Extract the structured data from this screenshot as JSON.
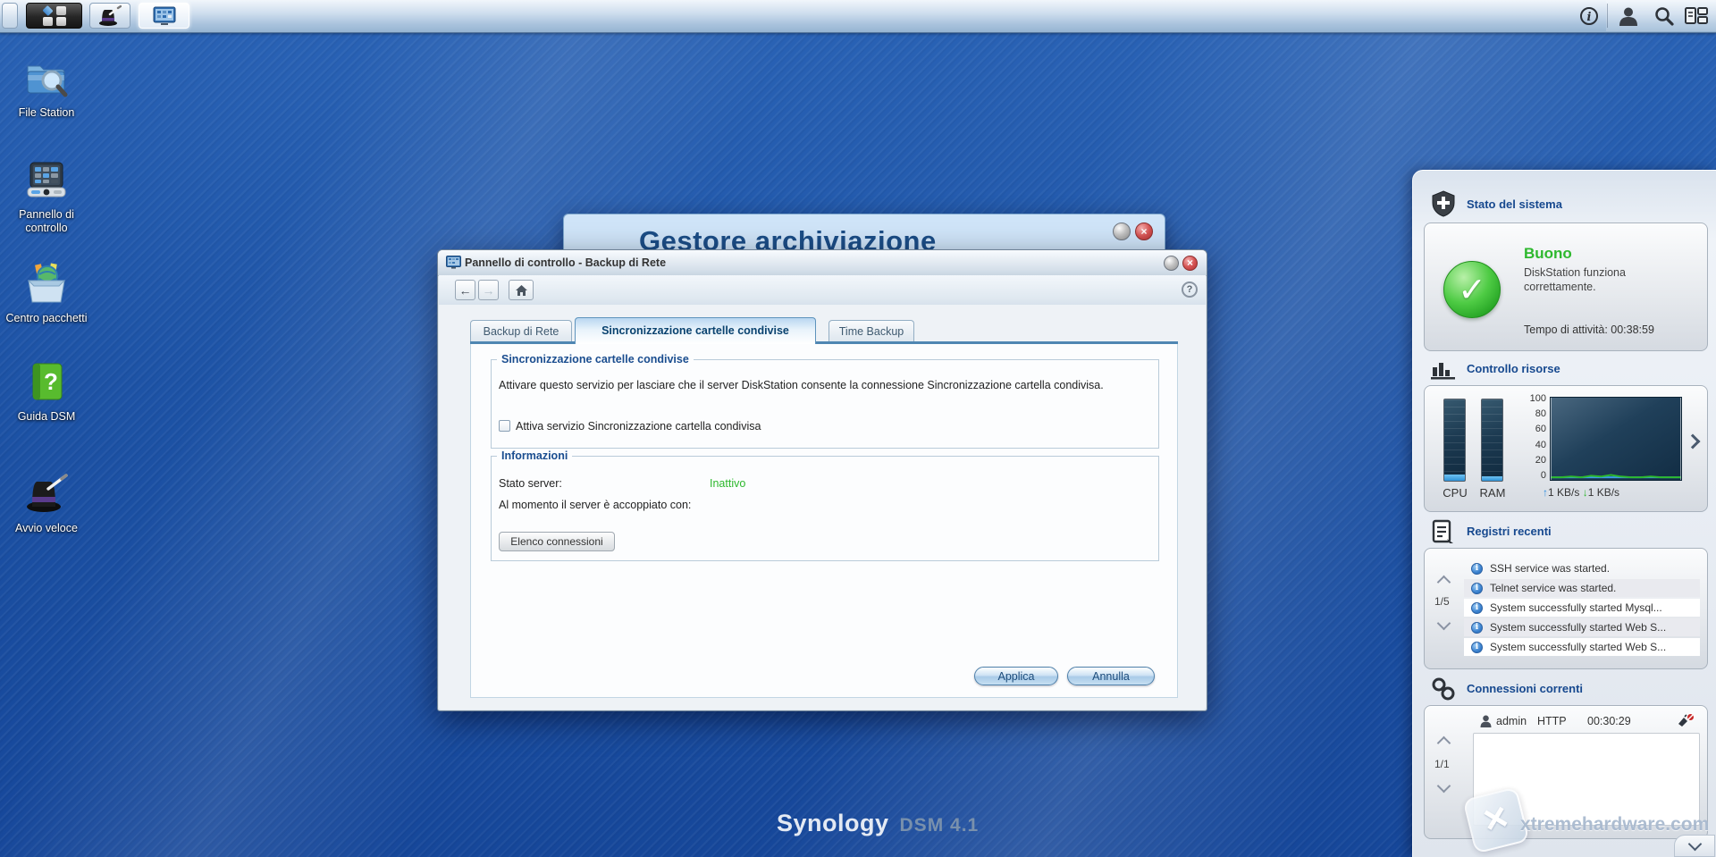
{
  "taskbar": {
    "icons": [
      "show-desktop",
      "main-menu",
      "quick-launch",
      "control-panel-window",
      "system-info",
      "user",
      "search",
      "pilot-view"
    ]
  },
  "desktop_icons": [
    {
      "label": "File Station",
      "icon": "file-station-icon"
    },
    {
      "label": "Pannello di controllo",
      "icon": "control-panel-icon"
    },
    {
      "label": "Centro pacchetti",
      "icon": "package-center-icon"
    },
    {
      "label": "Guida DSM",
      "icon": "dsm-help-icon"
    },
    {
      "label": "Avvio veloce",
      "icon": "quick-launch-icon"
    }
  ],
  "background_window": {
    "title": "Gestore archiviazione"
  },
  "dialog": {
    "title": "Pannello di controllo - Backup di Rete",
    "tabs": [
      {
        "label": "Backup di Rete"
      },
      {
        "label": "Sincronizzazione cartelle condivise"
      },
      {
        "label": "Time Backup"
      }
    ],
    "active_tab": "Sincronizzazione cartelle condivise",
    "sync_section": {
      "legend": "Sincronizzazione cartelle condivise",
      "description": "Attivare questo servizio per lasciare che il server DiskStation consente la connessione Sincronizzazione cartella condivisa.",
      "checkbox_label": "Attiva servizio Sincronizzazione cartella condivisa",
      "checkbox_checked": false
    },
    "info_section": {
      "legend": "Informazioni",
      "server_status_label": "Stato server:",
      "server_status_value": "Inattivo",
      "server_status_color": "#2db82d",
      "paired_label": "Al momento il server è accoppiato con:",
      "connections_button": "Elenco connessioni"
    },
    "apply_button": "Applica",
    "cancel_button": "Annulla"
  },
  "widgets": {
    "system_status": {
      "title": "Stato del sistema",
      "status": "Buono",
      "status_color": "#2eb82e",
      "description_line1": "DiskStation funziona",
      "description_line2": "correttamente.",
      "uptime": "Tempo di attività: 00:38:59"
    },
    "resource_monitor": {
      "title": "Controllo risorse",
      "cpu_label": "CPU",
      "ram_label": "RAM",
      "upload_rate": "1 KB/s",
      "download_rate": "1 KB/s",
      "chart_data": {
        "type": "line",
        "ylim": [
          0,
          100
        ],
        "y_ticks": [
          100,
          80,
          60,
          40,
          20,
          0
        ],
        "cpu_percent": 8,
        "ram_percent": 5,
        "series": [
          {
            "name": "upload KB/s",
            "color": "#3aa0e8",
            "values": [
              1,
              1,
              1,
              1,
              1,
              1,
              1,
              1,
              1,
              1,
              1,
              1,
              1,
              1
            ]
          },
          {
            "name": "download KB/s",
            "color": "#2db82d",
            "values": [
              1,
              1,
              2,
              1,
              3,
              2,
              4,
              2,
              1,
              1,
              2,
              1,
              1,
              1
            ]
          }
        ]
      }
    },
    "recent_logs": {
      "title": "Registri recenti",
      "pager": "1/5",
      "entries": [
        "SSH service was started.",
        "Telnet service was started.",
        "System successfully started Mysql...",
        "System successfully started Web S...",
        "System successfully started Web S..."
      ]
    },
    "current_connections": {
      "title": "Connessioni correnti",
      "pager": "1/1",
      "connections": [
        {
          "user": "admin",
          "protocol": "HTTP",
          "time": "00:30:29"
        }
      ]
    }
  },
  "footer": {
    "brand": "Synology",
    "version": "DSM 4.1",
    "watermark": "xtremehardware.com"
  }
}
